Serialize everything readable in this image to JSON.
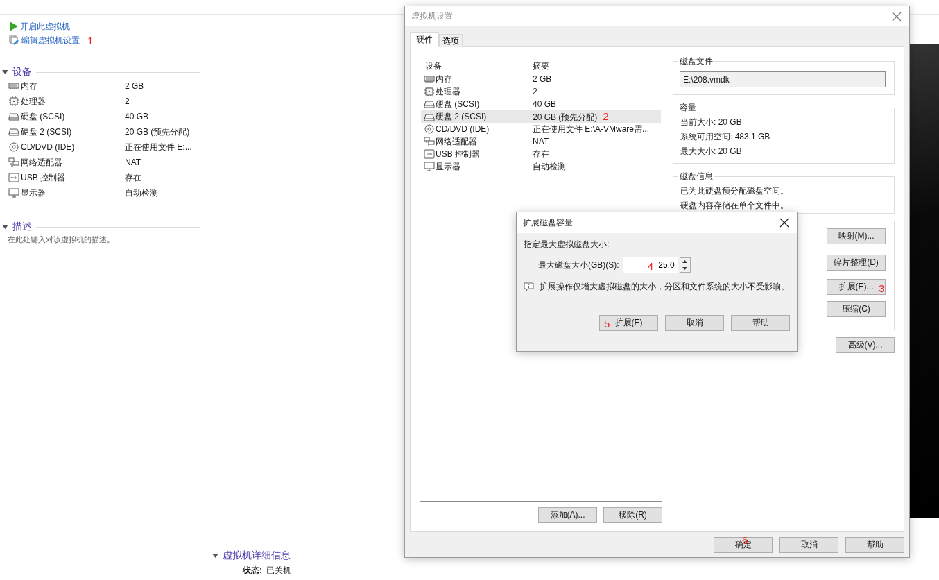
{
  "sidebar": {
    "actions": [
      {
        "kind": "power",
        "label": "开启此虚拟机"
      },
      {
        "kind": "edit",
        "label": "编辑虚拟机设置",
        "annotation": "1"
      }
    ],
    "devices_section": {
      "title": "设备",
      "expanded": true,
      "devices": [
        {
          "kind": "memory",
          "name": "内存",
          "summary": "2 GB"
        },
        {
          "kind": "cpu",
          "name": "处理器",
          "summary": "2"
        },
        {
          "kind": "disk",
          "name": "硬盘 (SCSI)",
          "summary": "40 GB"
        },
        {
          "kind": "disk",
          "name": "硬盘 2 (SCSI)",
          "summary": "20 GB (预先分配)"
        },
        {
          "kind": "cd",
          "name": "CD/DVD (IDE)",
          "summary": "正在使用文件 E:..."
        },
        {
          "kind": "network",
          "name": "网络适配器",
          "summary": "NAT"
        },
        {
          "kind": "usb",
          "name": "USB 控制器",
          "summary": "存在"
        },
        {
          "kind": "display",
          "name": "显示器",
          "summary": "自动检测"
        }
      ]
    },
    "description_section": {
      "title": "描述",
      "expanded": true,
      "placeholder": "在此处键入对该虚拟机的描述。"
    }
  },
  "details_section": {
    "title": "虚拟机详细信息",
    "expanded": true,
    "fields": [
      {
        "label": "状态:",
        "value": "已关机"
      }
    ]
  },
  "settings_dialog": {
    "title": "虚拟机设置",
    "tabs": [
      {
        "label": "硬件",
        "selected": true
      },
      {
        "label": "选项",
        "selected": false
      }
    ],
    "device_list": {
      "columns": [
        "设备",
        "摘要"
      ],
      "rows": [
        {
          "kind": "memory",
          "name": "内存",
          "summary": "2 GB",
          "selected": false
        },
        {
          "kind": "cpu",
          "name": "处理器",
          "summary": "2",
          "selected": false
        },
        {
          "kind": "disk",
          "name": "硬盘 (SCSI)",
          "summary": "40 GB",
          "selected": false
        },
        {
          "kind": "disk",
          "name": "硬盘 2 (SCSI)",
          "summary": "20 GB (预先分配)",
          "selected": true,
          "annotation": "2"
        },
        {
          "kind": "cd",
          "name": "CD/DVD (IDE)",
          "summary": "正在使用文件 E:\\A-VMware需...",
          "selected": false
        },
        {
          "kind": "network",
          "name": "网络适配器",
          "summary": "NAT",
          "selected": false
        },
        {
          "kind": "usb",
          "name": "USB 控制器",
          "summary": "存在",
          "selected": false
        },
        {
          "kind": "display",
          "name": "显示器",
          "summary": "自动检测",
          "selected": false
        }
      ]
    },
    "list_buttons": [
      {
        "label": "添加(A)..."
      },
      {
        "label": "移除(R)"
      }
    ],
    "disk_file": {
      "title": "磁盘文件",
      "value": "E:\\208.vmdk"
    },
    "capacity": {
      "title": "容量",
      "lines": [
        "当前大小: 20 GB",
        "系统可用空间: 483.1 GB",
        "最大大小: 20 GB"
      ]
    },
    "disk_info": {
      "title": "磁盘信息",
      "lines": [
        "已为此硬盘预分配磁盘空间。",
        "硬盘内容存储在单个文件中。"
      ]
    },
    "utility_buttons": [
      {
        "label": "映射(M)..."
      },
      {
        "label": "碎片整理(D)"
      },
      {
        "label": "扩展(E)...",
        "annotation": "3"
      },
      {
        "label": "压缩(C)"
      }
    ],
    "advanced_button": {
      "label": "高级(V)..."
    },
    "footer_buttons": [
      {
        "label": "确定",
        "annotation": "6"
      },
      {
        "label": "取消"
      },
      {
        "label": "帮助"
      }
    ]
  },
  "expand_dialog": {
    "title": "扩展磁盘容量",
    "prompt": "指定最大虚拟磁盘大小:",
    "size_field": {
      "label": "最大磁盘大小(GB)(S):",
      "value": "25.0",
      "annotation": "4"
    },
    "note": "扩展操作仅增大虚拟磁盘的大小，分区和文件系统的大小不受影响。",
    "buttons": [
      {
        "label": "扩展(E)",
        "annotation": "5"
      },
      {
        "label": "取消"
      },
      {
        "label": "帮助"
      }
    ]
  }
}
